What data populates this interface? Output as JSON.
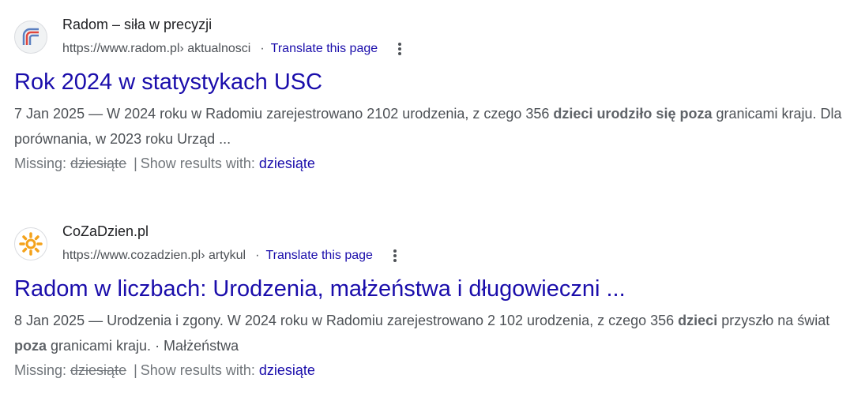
{
  "results": [
    {
      "site_name": "Radom – siła w precyzji",
      "url_host": "https://www.radom.pl",
      "url_path": " › aktualnosci",
      "translate": "Translate this page",
      "title": "Rok 2024 w statystykach USC",
      "date": "7 Jan 2025",
      "dash": " — ",
      "snippet_parts": [
        "W 2024 roku w Radomiu zarejestrowano 2102 urodzenia, z czego 356 ",
        "dzieci urodziło się",
        " ",
        "poza",
        " granicami kraju. Dla porównania, w 2023 roku Urząd ..."
      ],
      "missing_label": "Missing:",
      "missing_term": "dziesiąte",
      "show_label": "Show results with:",
      "show_term": "dziesiąte"
    },
    {
      "site_name": "CoZaDzien.pl",
      "url_host": "https://www.cozadzien.pl",
      "url_path": " › artykul",
      "translate": "Translate this page",
      "title": "Radom w liczbach: Urodzenia, małżeństwa i długowieczni ...",
      "date": "8 Jan 2025",
      "dash": " — ",
      "snippet_parts": [
        "Urodzenia i zgony. W 2024 roku w Radomiu zarejestrowano 2 102 urodzenia, z czego 356 ",
        "dzieci",
        " przyszło na świat ",
        "poza",
        " granicami kraju. · Małżeństwa"
      ],
      "missing_label": "Missing:",
      "missing_term": "dziesiąte",
      "show_label": "Show results with:",
      "show_term": "dziesiąte"
    }
  ],
  "colors": {
    "link": "#1a0dab",
    "text": "#4d5156",
    "site": "#202124"
  },
  "icons": [
    "radom-logo-icon",
    "cozadzien-sun-icon",
    "more-vert-icon"
  ]
}
